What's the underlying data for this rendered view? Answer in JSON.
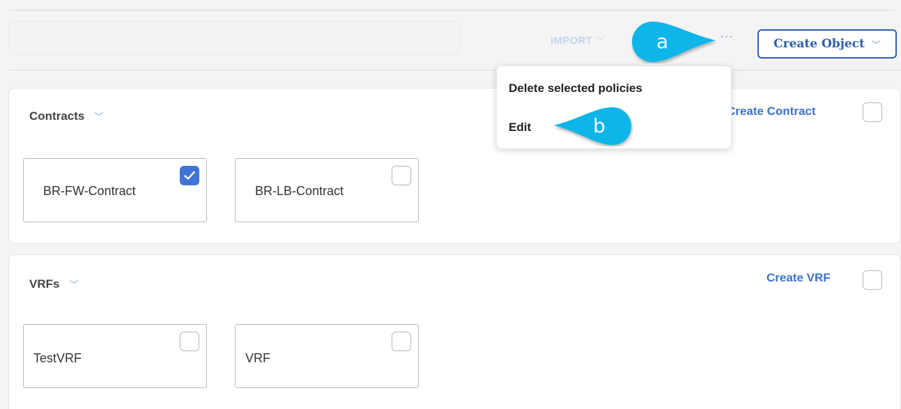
{
  "toolbar": {
    "import_label": "IMPORT",
    "more_label": "···",
    "create_object_label": "Create Object"
  },
  "menu": {
    "items": [
      {
        "label": "Delete selected policies"
      },
      {
        "label": "Edit"
      }
    ]
  },
  "contracts": {
    "title": "Contracts",
    "create_label": "Create Contract",
    "items": [
      {
        "name": "BR-FW-Contract",
        "checked": true
      },
      {
        "name": "BR-LB-Contract",
        "checked": false
      }
    ]
  },
  "vrfs": {
    "title": "VRFs",
    "create_label": "Create VRF",
    "items": [
      {
        "name": "TestVRF",
        "checked": false
      },
      {
        "name": "VRF",
        "checked": false
      }
    ]
  },
  "callouts": {
    "a": "a",
    "b": "b"
  },
  "colors": {
    "accent": "#3e72c7",
    "callout": "#11b5e8",
    "checked": "#3f74d6"
  }
}
